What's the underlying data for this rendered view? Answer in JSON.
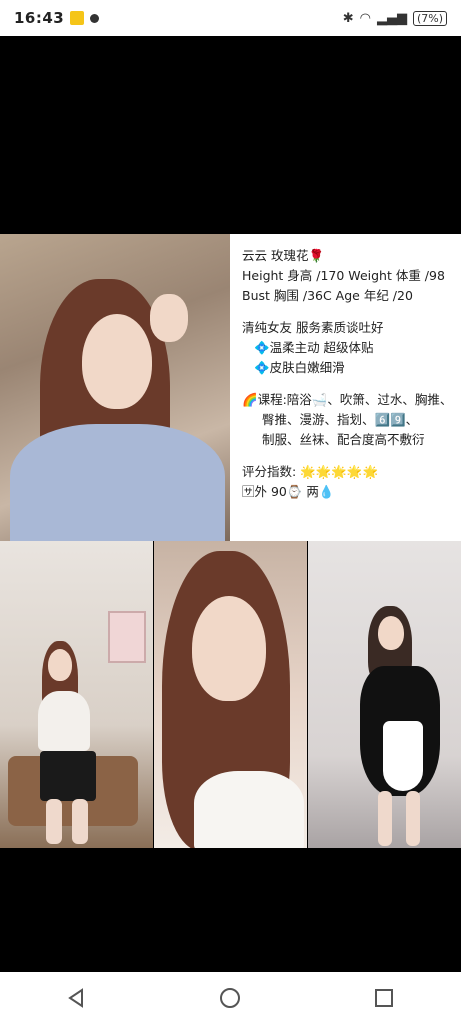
{
  "status_bar": {
    "time": "16:43",
    "battery": "(7%)"
  },
  "poster": {
    "lines": [
      "云云 玫瑰花🌹",
      "Height 身高 /170 Weight 体重 /98",
      "Bust 胸围 /36C     Age 年纪 /20",
      "清纯女友      服务素质谈吐好",
      "💠温柔主动  超级体贴",
      "💠皮肤白嫩细滑",
      "🌈课程:陪浴🛁、吹箫、过水、胸推、",
      "臀推、漫游、指划、6️⃣9️⃣、",
      "制服、丝袜、配合度高不敷衍",
      "评分指数: 🌟🌟🌟🌟🌟",
      "🈂外 90⌚ 两💧"
    ]
  },
  "nav": {
    "back": "back",
    "home": "home",
    "recents": "recents"
  },
  "colors": {
    "background": "#000000",
    "bar": "#ffffff"
  }
}
